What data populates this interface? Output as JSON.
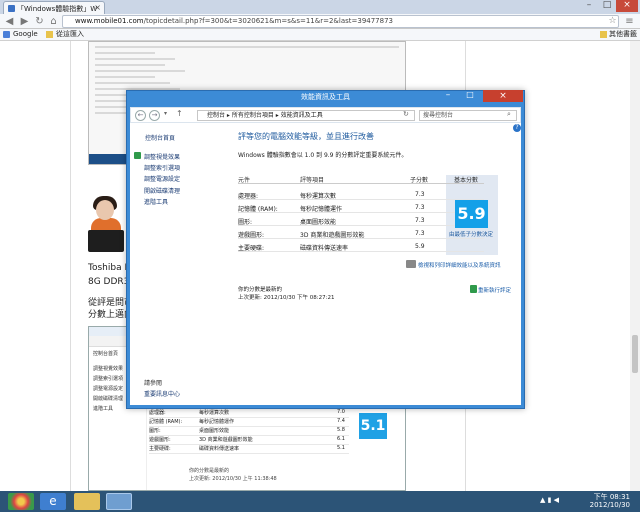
{
  "browser": {
    "tab_title": "「Windows體驗指數」W",
    "tab_close": "×",
    "url_prefix": "www.mobile01.com",
    "url_rest": "/topicdetail.php?f=300&t=3020621&m=s&s=11&r=2&last=39477873",
    "bookmarks": {
      "google": "Google",
      "import": "從這匯入",
      "other": "其他書籤"
    },
    "window_controls": {
      "minimize": "–",
      "maximize": "□",
      "close": "×"
    }
  },
  "page": {
    "product_line1": "Toshiba R",
    "product_line2": "8G DDR3",
    "text_line1": "從評是問市",
    "text_line2": "分數上邁向"
  },
  "bg_shot": {
    "score": "5.1",
    "nav": [
      "控制台首頁",
      "調整視覺效果",
      "調整索引選項",
      "調整電源設定",
      "開啟磁碟清理",
      "進階工具"
    ],
    "rows": [
      [
        "處理器:",
        "每秒運算次數",
        "7.0"
      ],
      [
        "記憶體 (RAM):",
        "每秒記憶體運作",
        "7.4"
      ],
      [
        "圖形:",
        "桌面圖形效能",
        "5.8"
      ],
      [
        "遊戲圖形:",
        "3D 商業和遊戲圖形效能",
        "6.1"
      ],
      [
        "主要硬碟:",
        "磁碟資料傳送速率",
        "5.1"
      ]
    ],
    "see_also": "請參閱",
    "action_center": "重要訊息中心",
    "footer1": "你的分數是最新的",
    "footer2": "上次更新: 2012/10/30 上午 11:38:48"
  },
  "dialog": {
    "title": "效能資訊及工具",
    "breadcrumb": [
      "控制台",
      "所有控制台項目",
      "效能資訊及工具"
    ],
    "search_placeholder": "搜尋控制台",
    "nav": [
      "控制台首頁",
      "調整視覺效果",
      "調整索引選項",
      "調整電源設定",
      "開啟磁碟清理",
      "進階工具"
    ],
    "see_also": "請參閱",
    "action_center": "重要訊息中心",
    "heading": "評等您的電腦效能等級，並且進行改善",
    "subtitle": "Windows 體驗指數會以 1.0 到 9.9 的分數評定重要系統元件。",
    "col_component": "元件",
    "col_rated": "評等項目",
    "col_subscore": "子分數",
    "col_base": "基本分數",
    "rows": [
      {
        "component": "處理器:",
        "rated": "每秒運算次數",
        "score": "7.3"
      },
      {
        "component": "記憶體 (RAM):",
        "rated": "每秒記憶體運作",
        "score": "7.3"
      },
      {
        "component": "圖形:",
        "rated": "桌面圖形效能",
        "score": "7.3"
      },
      {
        "component": "遊戲圖形:",
        "rated": "3D 商業和遊戲圖形效能",
        "score": "7.3"
      },
      {
        "component": "主要硬碟:",
        "rated": "磁碟資料傳送速率",
        "score": "5.9"
      }
    ],
    "base_score": "5.9",
    "base_caption": "由最低子分數決定",
    "link_details": "檢視和列印詳細效能以及系統資訊",
    "status1": "你的分數是最新的",
    "status2": "上次更新: 2012/10/30 下午 08:27:21",
    "rerun": "重新執行評定"
  },
  "taskbar": {
    "time": "下午 08:31",
    "date": "2012/10/30"
  },
  "colors": {
    "accent": "#3c8bd6",
    "score": "#14a0e8",
    "taskbar": "#2c5477"
  }
}
